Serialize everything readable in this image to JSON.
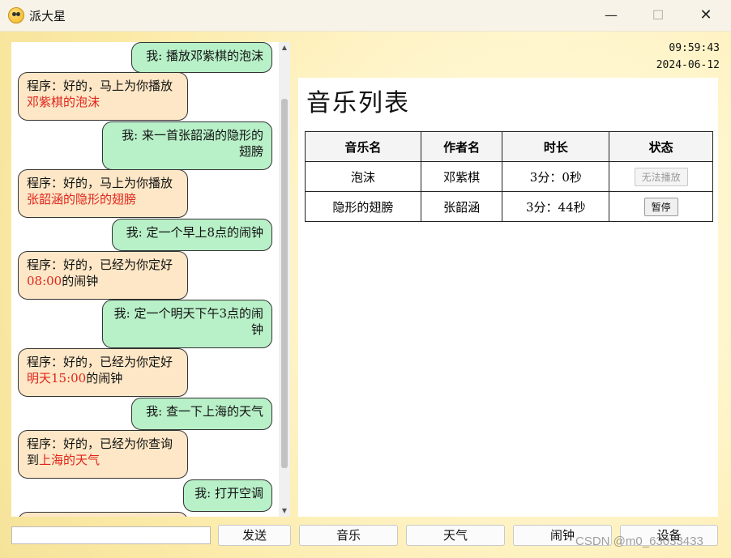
{
  "window": {
    "title": "派大星",
    "minimize": "—",
    "maximize": "☐",
    "close": "✕"
  },
  "chat": {
    "messages": [
      {
        "who": "me",
        "text": "我: 播放邓紫棋的泡沫"
      },
      {
        "who": "bot",
        "parts": [
          {
            "t": "程序：好的，马上为你播放"
          },
          {
            "t": "邓紫棋的泡沫",
            "hl": true
          }
        ]
      },
      {
        "who": "me",
        "text": "我: 来一首张韶涵的隐形的翅膀"
      },
      {
        "who": "bot",
        "parts": [
          {
            "t": "程序：好的，马上为你播放"
          },
          {
            "t": "张韶涵的隐形的翅膀",
            "hl": true
          }
        ]
      },
      {
        "who": "me",
        "text": "我: 定一个早上8点的闹钟"
      },
      {
        "who": "bot",
        "parts": [
          {
            "t": "程序：好的，已经为你定好"
          },
          {
            "t": "08:00",
            "hl": true
          },
          {
            "t": "的闹钟"
          }
        ]
      },
      {
        "who": "me",
        "text": "我: 定一个明天下午3点的闹钟"
      },
      {
        "who": "bot",
        "parts": [
          {
            "t": "程序：好的，已经为你定好"
          },
          {
            "t": "明天15:00",
            "hl": true
          },
          {
            "t": "的闹钟"
          }
        ]
      },
      {
        "who": "me",
        "text": "我: 查一下上海的天气"
      },
      {
        "who": "bot",
        "parts": [
          {
            "t": "程序：好的，已经为你查询到"
          },
          {
            "t": "上海的天气",
            "hl": true
          }
        ]
      },
      {
        "who": "me",
        "text": "我: 打开空调"
      }
    ]
  },
  "clock": {
    "time": "09:59:43",
    "date": "2024-06-12"
  },
  "music": {
    "title": "音乐列表",
    "headers": [
      "音乐名",
      "作者名",
      "时长",
      "状态"
    ],
    "rows": [
      {
        "name": "泡沫",
        "artist": "邓紫棋",
        "duration": "3分：0秒",
        "action": "无法播放"
      },
      {
        "name": "隐形的翅膀",
        "artist": "张韶涵",
        "duration": "3分：44秒",
        "action": "暂停"
      }
    ]
  },
  "bottom": {
    "input_value": "",
    "send": "发送",
    "music": "音乐",
    "weather": "天气",
    "alarm": "闹钟",
    "device": "设备"
  },
  "watermark": "CSDN @m0_63033433",
  "colors": {
    "me_bubble": "#b8f0c8",
    "bot_bubble": "#fde7c6",
    "highlight": "#e0241c"
  }
}
